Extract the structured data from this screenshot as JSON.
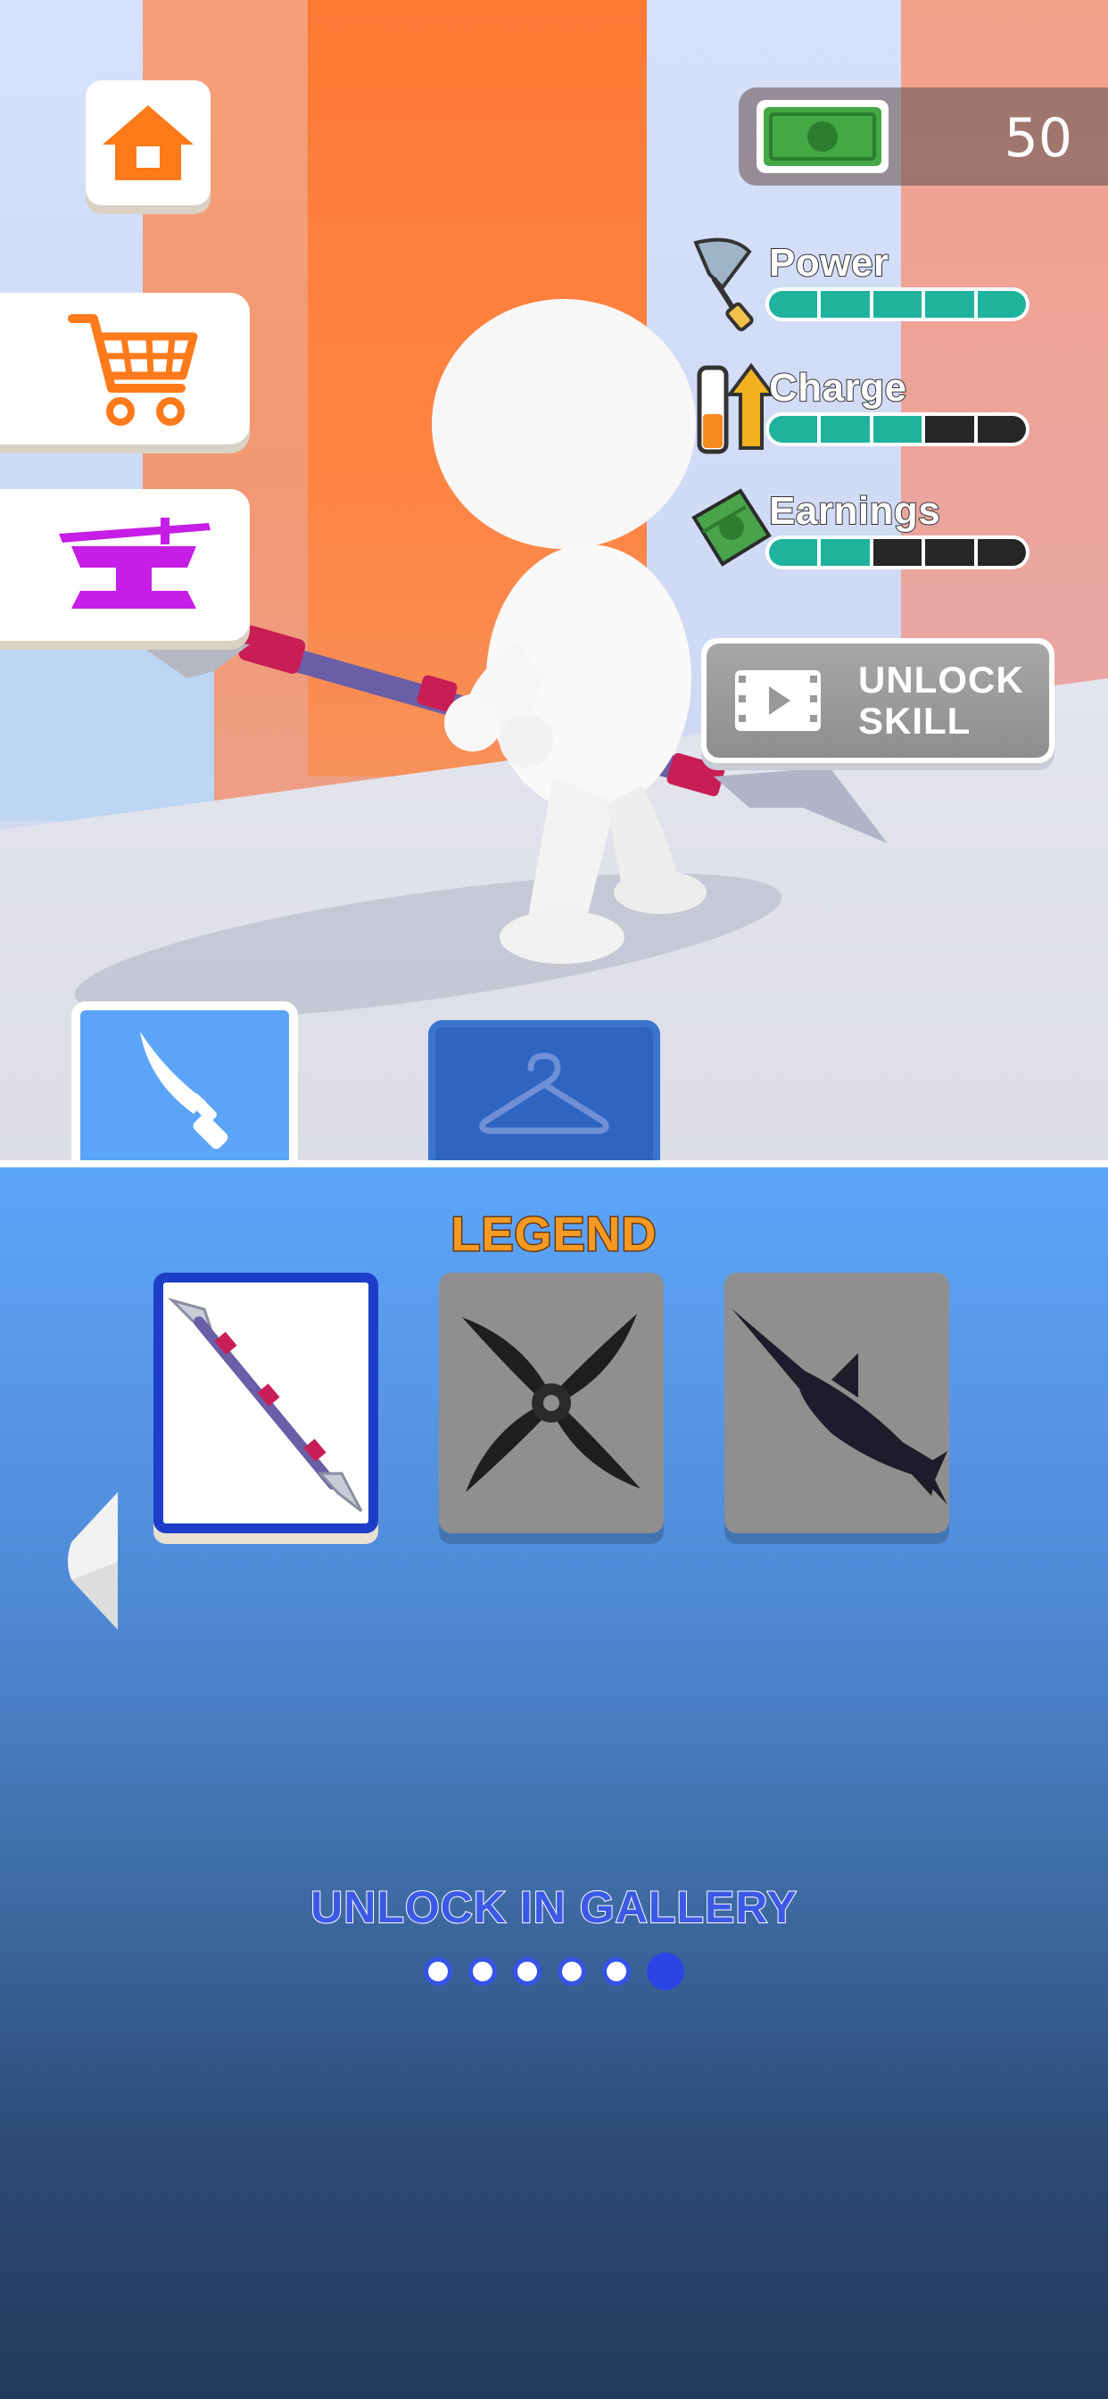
{
  "hud": {
    "money": "50",
    "stats": {
      "power": {
        "label": "Power",
        "level": 5,
        "max": 5
      },
      "charge": {
        "label": "Charge",
        "level": 3,
        "max": 5
      },
      "earnings": {
        "label": "Earnings",
        "level": 2,
        "max": 5
      }
    },
    "unlock_skill_label": "UNLOCK SKILL",
    "unlock_skill_line1": "UNLOCK",
    "unlock_skill_line2": "SKILL"
  },
  "side_buttons": [
    {
      "icon": "home-icon",
      "color": "#ff7a1a"
    },
    {
      "icon": "shopping-cart-icon",
      "color": "#ff7a1a"
    },
    {
      "icon": "anvil-forge-icon",
      "color": "#c61ee6"
    }
  ],
  "tabs": [
    {
      "icon": "knife-icon",
      "selected": true
    },
    {
      "icon": "hanger-icon",
      "selected": false
    }
  ],
  "panel": {
    "rarity_title": "LEGEND",
    "items": [
      {
        "icon": "double-blade-staff-icon",
        "selected": true,
        "locked": false
      },
      {
        "icon": "shuriken-icon",
        "selected": false,
        "locked": true
      },
      {
        "icon": "swordfish-icon",
        "selected": false,
        "locked": true
      }
    ],
    "unlock_text": "UNLOCK IN GALLERY",
    "page": {
      "current": 6,
      "total": 6
    }
  },
  "colors": {
    "accent_orange": "#ff7a1a",
    "bar_fill": "#1fb39e",
    "panel_blue": "#5ba5fb",
    "selection_blue": "#1d3ec8"
  }
}
